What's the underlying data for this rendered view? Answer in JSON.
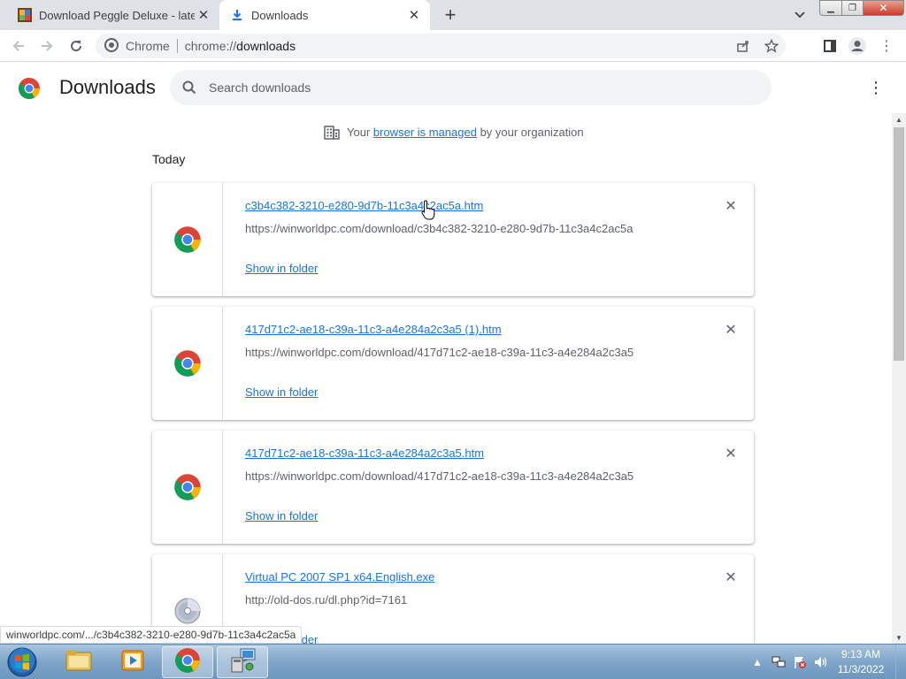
{
  "tabs": [
    {
      "title": "Download Peggle Deluxe - latest",
      "active": false,
      "favicon": "peggle-icon"
    },
    {
      "title": "Downloads",
      "active": true,
      "favicon": "download-icon"
    }
  ],
  "omnibox": {
    "site_label": "Chrome",
    "url_scheme": "chrome://",
    "url_path": "downloads"
  },
  "header": {
    "title": "Downloads",
    "search_placeholder": "Search downloads"
  },
  "managed": {
    "prefix": "Your ",
    "link": "browser is managed",
    "suffix": " by your organization"
  },
  "section_label": "Today",
  "downloads": [
    {
      "filename": "c3b4c382-3210-e280-9d7b-11c3a4c2ac5a.htm",
      "url": "https://winworldpc.com/download/c3b4c382-3210-e280-9d7b-11c3a4c2ac5a",
      "action": "Show in folder",
      "icon": "chrome-file-icon"
    },
    {
      "filename": "417d71c2-ae18-c39a-11c3-a4e284a2c3a5 (1).htm",
      "url": "https://winworldpc.com/download/417d71c2-ae18-c39a-11c3-a4e284a2c3a5",
      "action": "Show in folder",
      "icon": "chrome-file-icon"
    },
    {
      "filename": "417d71c2-ae18-c39a-11c3-a4e284a2c3a5.htm",
      "url": "https://winworldpc.com/download/417d71c2-ae18-c39a-11c3-a4e284a2c3a5",
      "action": "Show in folder",
      "icon": "chrome-file-icon"
    },
    {
      "filename": "Virtual PC 2007 SP1 x64.English.exe",
      "url": "http://old-dos.ru/dl.php?id=7161",
      "action": "Show in folder",
      "icon": "disc-file-icon"
    }
  ],
  "status_bubble": "winworldpc.com/.../c3b4c382-3210-e280-9d7b-11c3a4c2ac5a",
  "taskbar": {
    "time": "9:13 AM",
    "date": "11/3/2022"
  },
  "colors": {
    "link": "#1a73e8",
    "tabstrip": "#dee1e6",
    "omnibox": "#f1f3f4"
  }
}
